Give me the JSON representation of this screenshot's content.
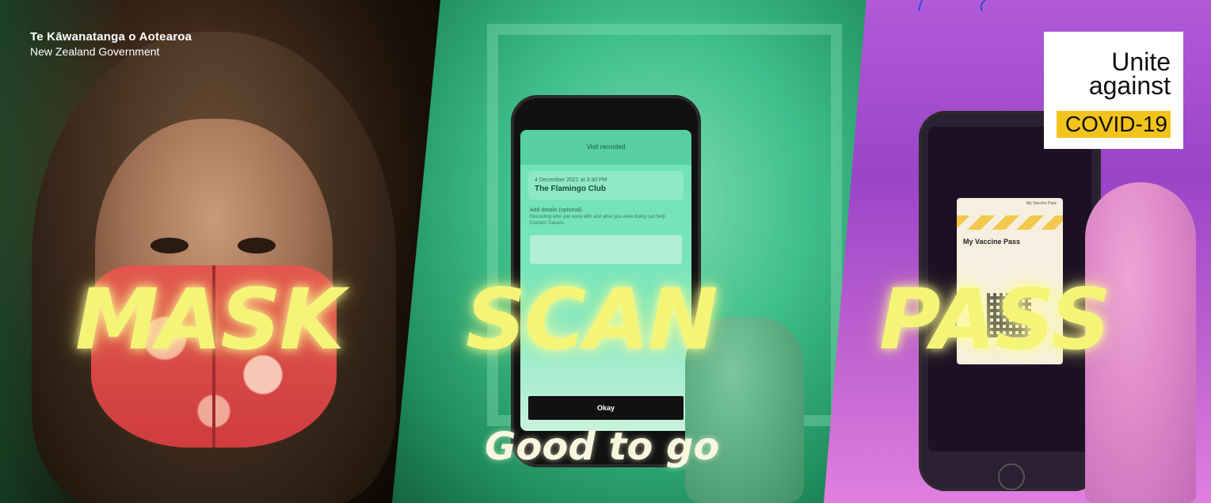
{
  "government": {
    "maori_name": "Te Kāwanatanga o Aotearoa",
    "english_name": "New Zealand Government"
  },
  "panels": [
    {
      "word": "MASK"
    },
    {
      "word": "SCAN"
    },
    {
      "word": "PASS"
    }
  ],
  "tagline": "Good to go",
  "campaign_logo": {
    "line1": "Unite",
    "line2": "against",
    "line3": "COVID-19"
  },
  "scan_phone": {
    "header": "Visit recorded",
    "date": "4 December 2021 at 3:30 PM",
    "venue": "The Flamingo Club",
    "details_label": "Add details (optional)",
    "details_desc": "Recording who you were with and what you were doing can help Contact Tracers.",
    "button": "Okay"
  },
  "pass_phone": {
    "card_title": "My Vaccine Pass",
    "card_small": "My Vaccine Pass"
  },
  "colors": {
    "word_yellow": "#f4f577",
    "logo_yellow": "#f2c31b",
    "panel_green": "#3fbf8c",
    "panel_purple": "#b15ad8"
  }
}
